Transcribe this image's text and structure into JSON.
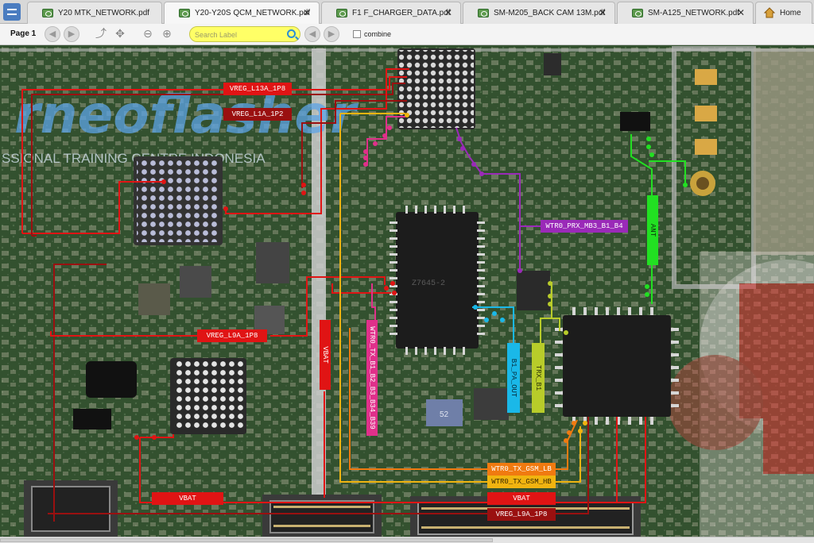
{
  "tabs": [
    {
      "label": "Y20 MTK_NETWORK.pdf",
      "close": "✕"
    },
    {
      "label": "Y20-Y20S QCM_NETWORK.pdf",
      "close": "✕"
    },
    {
      "label": "F1 F_CHARGER_DATA.pdf",
      "close": "✕"
    },
    {
      "label": "SM-M205_BACK CAM 13M.pdf",
      "close": "✕"
    },
    {
      "label": "SM-A125_NETWORK.pdf",
      "close": "✕"
    },
    {
      "label": "Home"
    }
  ],
  "toolbar": {
    "page_label": "Page 1",
    "back_glyph": "◀",
    "forward_glyph": "▶",
    "export_glyph": "⤴",
    "move_glyph": "✥",
    "zoom_out_glyph": "⊖",
    "zoom_in_glyph": "⊕",
    "search_placeholder": "Search Label",
    "prev_glyph": "◀",
    "next_glyph": "▶",
    "combine_label": "combine"
  },
  "board": {
    "watermark_line1": "rneoflasher",
    "watermark_line2": "SSIONAL TRAINING CENTRE INDONESIA",
    "chip_mark": "Z7645-2",
    "chip_small_mark": "52",
    "labels": {
      "vreg_l13a": "VREG_L13A_1P8",
      "vreg_l1a": "VREG_L1A_1P2",
      "wtr0_prx": "WTR0_PRX_MB3_B1_B4",
      "ant": "ANT",
      "vreg_l9a_mid": "VREG_L9A_1P8",
      "vbat_vertical": "VBAT",
      "wtr0_tx": "WTR0_TX_B1_B2_B3_B34_B39",
      "b1_pa_out": "B1_PA_OUT",
      "trx_b1": "TRX_B1",
      "wtr0_tx_gsm_lb": "WTR0_TX_GSM_LB",
      "wtr0_tx_gsm_hb": "WTR0_TX_GSM_HB",
      "vbat_left": "VBAT",
      "vbat_right": "VBAT",
      "vreg_l9a_bottom": "VREG_L9A_1P8"
    }
  },
  "colors": {
    "pcb": "#2f4a2c",
    "red_net": "#e01414",
    "dark_red_net": "#9a1010",
    "magenta_net": "#e0308a",
    "purple_net": "#9a2ab8",
    "green_net": "#22e022",
    "cyan_net": "#1ab8e8",
    "olive_net": "#b8cc2a",
    "orange_net": "#f07a10",
    "yellow_net": "#f0b410",
    "search_bg": "#ffff66"
  }
}
